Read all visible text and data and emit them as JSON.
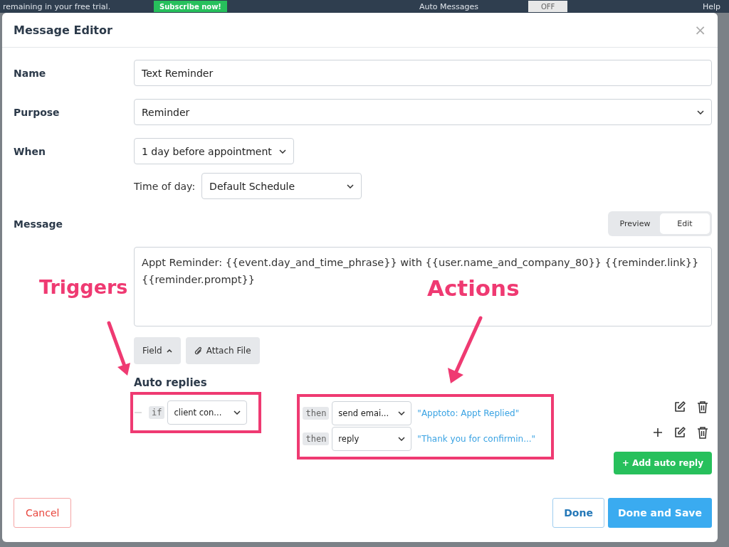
{
  "background": {
    "notice": "remaining in your free trial.",
    "subscribe_button": "Subscribe now!",
    "page_title": "Auto Messages",
    "toggle": "OFF",
    "help": "Help"
  },
  "dialog": {
    "title": "Message Editor",
    "close": "×",
    "fields": [
      {
        "label": "Name",
        "kind": "text",
        "value": "Text Reminder"
      },
      {
        "label": "Purpose",
        "kind": "select",
        "value": "Reminder"
      },
      {
        "label": "When",
        "kind": "compact-select",
        "value": "1 day before appointment"
      }
    ],
    "time_of_day": {
      "label": "Time of day:",
      "value": "Default Schedule"
    },
    "message": {
      "label": "Message",
      "modes": [
        {
          "label": "Preview",
          "selected": false
        },
        {
          "label": "Edit",
          "selected": true
        }
      ],
      "text": "Appt Reminder: {{event.day_and_time_phrase}} with {{user.name_and_company_80}} {{reminder.link}} {{reminder.prompt}}",
      "field_button": "Field",
      "attach_button": "Attach File"
    },
    "auto_replies": {
      "heading": "Auto replies",
      "trigger": {
        "keyword": "if",
        "value": "client con..."
      },
      "actions": [
        {
          "keyword": "then",
          "value": "send emai...",
          "detail": "\"Apptoto: Appt Replied\"",
          "can_add": false
        },
        {
          "keyword": "then",
          "value": "reply",
          "detail": "\"Thank you for confirmin...\"",
          "can_add": true
        }
      ],
      "add_button": "+ Add auto reply"
    },
    "footer": {
      "cancel": "Cancel",
      "done": "Done",
      "save": "Done and Save"
    }
  },
  "annotations": [
    {
      "kind": "triggers",
      "label": "Triggers"
    },
    {
      "kind": "actions",
      "label": "Actions"
    }
  ]
}
